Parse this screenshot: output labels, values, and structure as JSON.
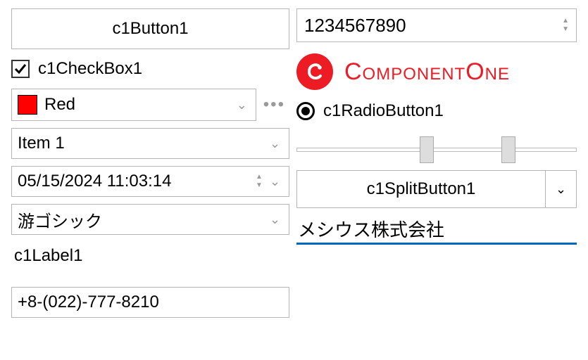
{
  "left": {
    "button_label": "c1Button1",
    "checkbox_label": "c1CheckBox1",
    "color_picker": {
      "swatch": "#ff0000",
      "label": "Red"
    },
    "dropdown_value": "Item 1",
    "datetime_value": "05/15/2024 11:03:14",
    "font_value": "游ゴシック",
    "label_text": "c1Label1",
    "masked_value": "+8-(022)-777-8210"
  },
  "right": {
    "numeric_value": "1234567890",
    "brand_text": "ComponentOne",
    "radio_label": "c1RadioButton1",
    "slider": {
      "thumb1_pct": 44,
      "thumb2_pct": 73
    },
    "split_label": "c1SplitButton1",
    "textbox_value": "メシウス株式会社"
  }
}
